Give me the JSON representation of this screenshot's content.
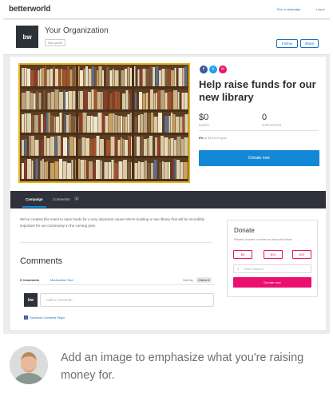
{
  "topnav": {
    "brand": "betterworld",
    "run_campaign": "Run a campaign",
    "login": "Log in"
  },
  "org": {
    "logo": "bw",
    "name": "Your Organization",
    "badge": "Non-profit",
    "follow_label": "Follow",
    "share_label": "Share"
  },
  "campaign": {
    "hero_alt": "bookshelf-photo",
    "social": [
      {
        "icon": "facebook-icon",
        "glyph": "f",
        "color": "#3b5998"
      },
      {
        "icon": "twitter-icon",
        "glyph": "t",
        "color": "#1da1f2"
      },
      {
        "icon": "email-icon",
        "glyph": "✉",
        "color": "#e9106e"
      }
    ],
    "title": "Help raise funds for our new library",
    "raised_value": "$0",
    "raised_label": "RAISED",
    "supporters_value": "0",
    "supporters_label": "SUPPORTERS",
    "progress_pct": "0%",
    "progress_rest": " of $10,000 goal",
    "progress_fraction": 0,
    "donate_label": "Donate now"
  },
  "tabs": {
    "campaign": "Campaign",
    "comments": "Comments",
    "comments_count": "0"
  },
  "content": {
    "description": "We've created this event to raise funds for a very important cause! We're building a new library that will be incredibly important for our community in the coming year."
  },
  "comments": {
    "title": "Comments",
    "count_label": "0 Comments",
    "moderation_tool": "Moderation Tool",
    "sort_label": "Sort by",
    "sort_value": "Oldest ▾",
    "avatar": "bw",
    "input_placeholder": "Add a comment...",
    "plugin_label": "Facebook Comments Plugin"
  },
  "donate_box": {
    "title": "Donate",
    "subtitle": "Please choose or enter an amount below",
    "amounts": [
      "$5",
      "$10",
      "$20"
    ],
    "input_prefix": "$",
    "input_placeholder": "Other amount",
    "button_label": "Donate now"
  },
  "caption": {
    "text": "Add an image to emphasize what you're raising money for."
  },
  "colors": {
    "accent_blue": "#1388d6",
    "accent_pink": "#e9106e",
    "tabbar": "#2f323a",
    "hero_border": "#e6b422"
  }
}
